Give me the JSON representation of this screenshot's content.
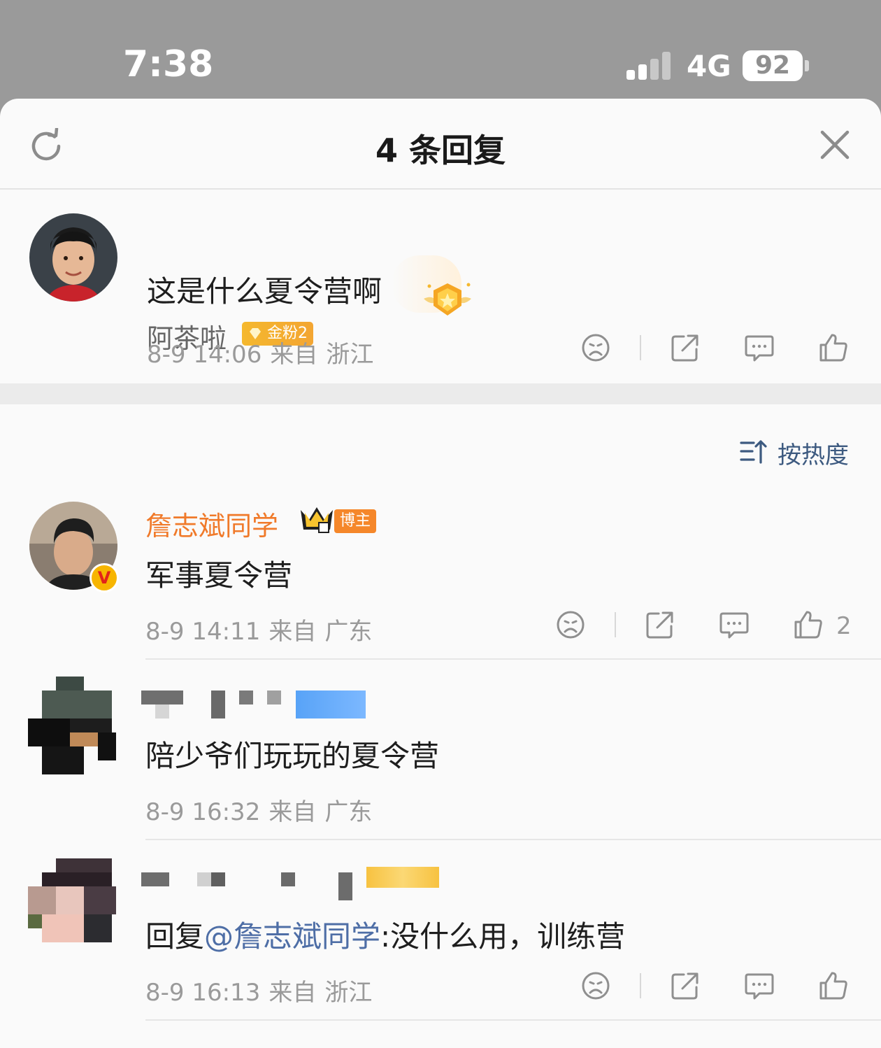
{
  "status_bar": {
    "time": "7:38",
    "network": "4G",
    "battery": "92"
  },
  "header": {
    "title": "4 条回复"
  },
  "root_comment": {
    "username": "阿茶啦",
    "badge": "金粉2",
    "text": "这是什么夏令营啊",
    "date": "8-9 14:06",
    "from": "来自",
    "location": "浙江"
  },
  "sort": {
    "label": "按热度"
  },
  "replies": [
    {
      "username": "詹志斌同学",
      "badge": "博主",
      "text": "军事夏令营",
      "date": "8-9 14:11",
      "from": "来自",
      "location": "广东",
      "likes": "2"
    },
    {
      "username": "",
      "text": "陪少爷们玩玩的夏令营",
      "date": "8-9 16:32",
      "from": "来自",
      "location": "广东"
    },
    {
      "username": "",
      "reply_prefix": "回复",
      "mention": "@詹志斌同学",
      "text": ":没什么用，训练营",
      "date": "8-9 16:13",
      "from": "来自",
      "location": "浙江"
    }
  ],
  "colors": {
    "accent_orange": "#f07a2a",
    "link_blue": "#4e6ea6",
    "gold": "#f5b82e"
  }
}
